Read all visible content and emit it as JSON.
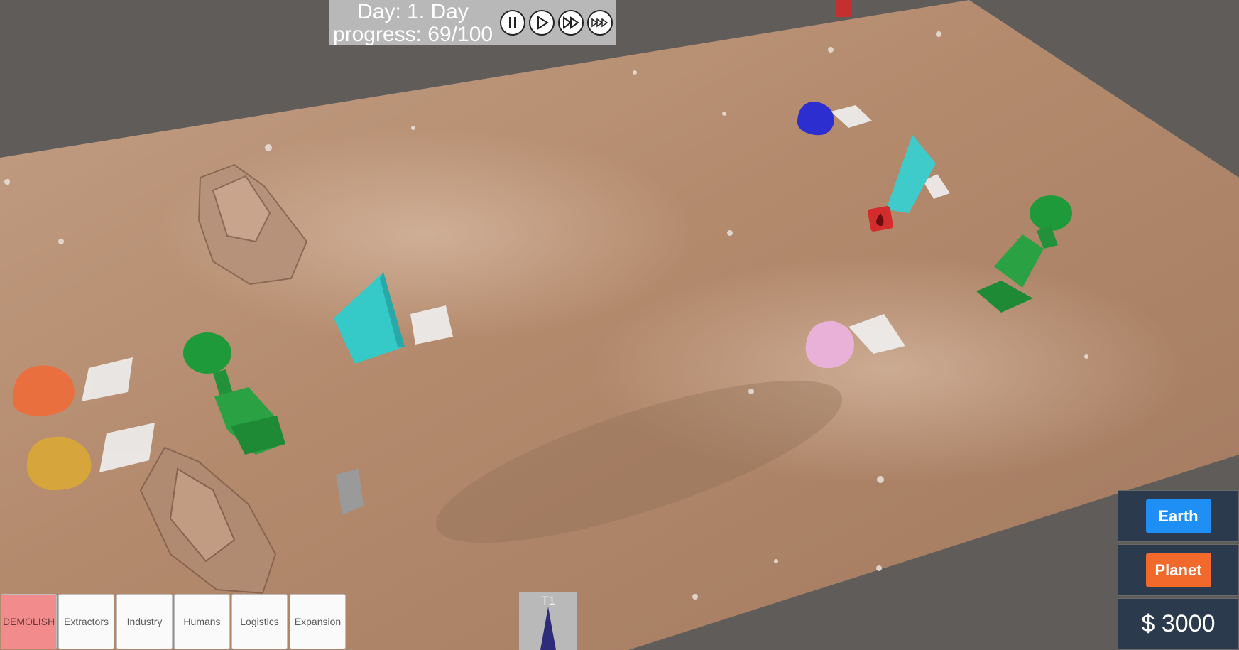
{
  "hud": {
    "day_text": "Day: 1. Day",
    "progress_text": "progress: 69/100",
    "speed_controls": [
      {
        "name": "pause-button",
        "icon": "pause-icon"
      },
      {
        "name": "play-button",
        "icon": "play-icon"
      },
      {
        "name": "fast-forward-button",
        "icon": "fast-forward-icon"
      },
      {
        "name": "fastest-forward-button",
        "icon": "fastest-forward-icon"
      }
    ]
  },
  "toolbar": {
    "categories": [
      "DEMOLISH",
      "Extractors",
      "Industry",
      "Humans",
      "Logistics",
      "Expansion"
    ]
  },
  "tier": {
    "label": "T1"
  },
  "side_panel": {
    "earth_label": "Earth",
    "planet_label": "Planet",
    "money": "$ 3000",
    "colors": {
      "earth": "#1e90f5",
      "planet": "#f26a2b",
      "panel": "#2c3a4d",
      "demolish": "#f28b8b"
    }
  }
}
